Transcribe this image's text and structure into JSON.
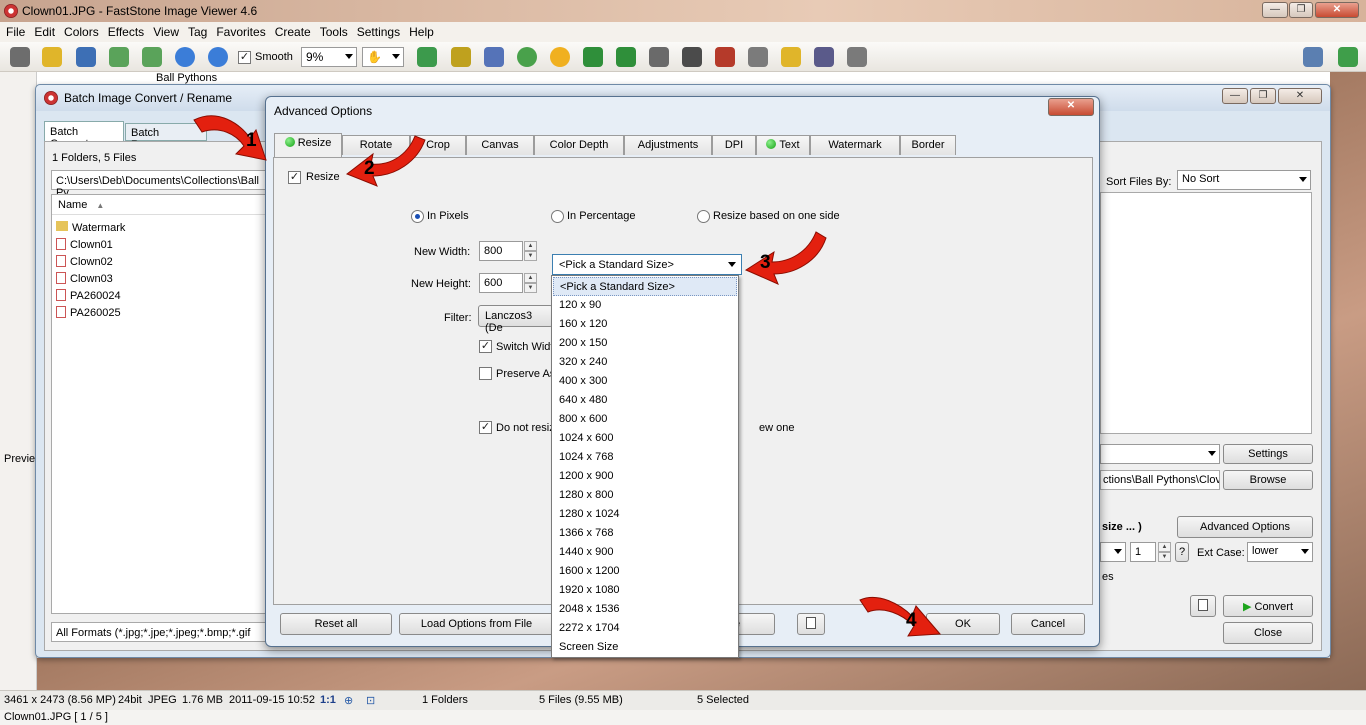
{
  "app": {
    "title": "Clown01.JPG  -  FastStone Image Viewer 4.6",
    "window_buttons": [
      "—",
      "❐",
      "✕"
    ]
  },
  "menu": [
    "File",
    "Edit",
    "Colors",
    "Effects",
    "View",
    "Tag",
    "Favorites",
    "Create",
    "Tools",
    "Settings",
    "Help"
  ],
  "toolbar": {
    "smooth_label": "Smooth",
    "smooth_checked": true,
    "zoom_value": "9%"
  },
  "tree": {
    "item": "Ball Pythons"
  },
  "batch": {
    "title": "Batch Image Convert / Rename",
    "tabs": [
      "Batch Convert",
      "Batch Rename"
    ],
    "folder_count": "1 Folders, 5 Files",
    "path": "C:\\Users\\Deb\\Documents\\Collections\\Ball Py",
    "name_header": "Name",
    "files": [
      "Watermark",
      "Clown01",
      "Clown02",
      "Clown03",
      "PA260024",
      "PA260025"
    ],
    "formats": "All Formats (*.jpg;*.jpe;*.jpeg;*.bmp;*.gif",
    "sort_label": "Sort Files By:",
    "sort_value": "No Sort",
    "settings_btn": "Settings",
    "browse_btn": "Browse",
    "output_path": "ctions\\Ball Pythons\\Clov",
    "size_hint": "size ... )",
    "adv_btn": "Advanced Options",
    "counter_value": "1",
    "ext_case_label": "Ext Case:",
    "ext_case_value": "lower",
    "es_text": "es",
    "convert_btn": "Convert",
    "close_btn": "Close",
    "question": "?"
  },
  "adv": {
    "title": "Advanced Options",
    "tabs": [
      "Resize",
      "Rotate",
      "Crop",
      "Canvas",
      "Color Depth",
      "Adjustments",
      "DPI",
      "Text",
      "Watermark",
      "Border"
    ],
    "resize_check_label": "Resize",
    "radio_pixels": "In Pixels",
    "radio_percent": "In Percentage",
    "radio_oneside": "Resize based on one side",
    "width_label": "New Width:",
    "width_value": "800",
    "height_label": "New Height:",
    "height_value": "600",
    "std_size": "<Pick a Standard Size>",
    "filter_label": "Filter:",
    "filter_value": "Lanczos3 (De",
    "switch_label": "Switch Widt",
    "preserve_label": "Preserve As",
    "donot_label": "Do not resiz",
    "donot_tail": "ew one",
    "reset_btn": "Reset all",
    "load_btn": "Load Options from File",
    "save_tail": "e",
    "ok_btn": "OK",
    "cancel_btn": "Cancel",
    "dropdown_items": [
      "<Pick a Standard Size>",
      "120 x 90",
      "160 x 120",
      "200 x 150",
      "320 x 240",
      "400 x 300",
      "640 x 480",
      "800 x 600",
      "1024 x 600",
      "1024 x 768",
      "1200 x 900",
      "1280 x 800",
      "1280 x 1024",
      "1366 x 768",
      "1440 x 900",
      "1600 x 1200",
      "1920 x 1080",
      "2048 x 1536",
      "2272 x 1704",
      "Screen Size"
    ]
  },
  "steps": [
    "1",
    "2",
    "3",
    "4"
  ],
  "preview_label": "Previe",
  "status": {
    "dims": "3461 x 2473 (8.56 MP)",
    "bits": "24bit",
    "format": "JPEG",
    "size": "1.76 MB",
    "date": "2011-09-15 10:52",
    "ratio": "1:1",
    "folders": "1 Folders",
    "files": "5 Files (9.55 MB)",
    "selected": "5 Selected"
  },
  "bottom": {
    "file": "Clown01.JPG [ 1 / 5 ]"
  },
  "colors": {
    "arrow_red": "#e3200f",
    "accent_blue": "#2a5da8",
    "green_dot": "#12a012"
  }
}
